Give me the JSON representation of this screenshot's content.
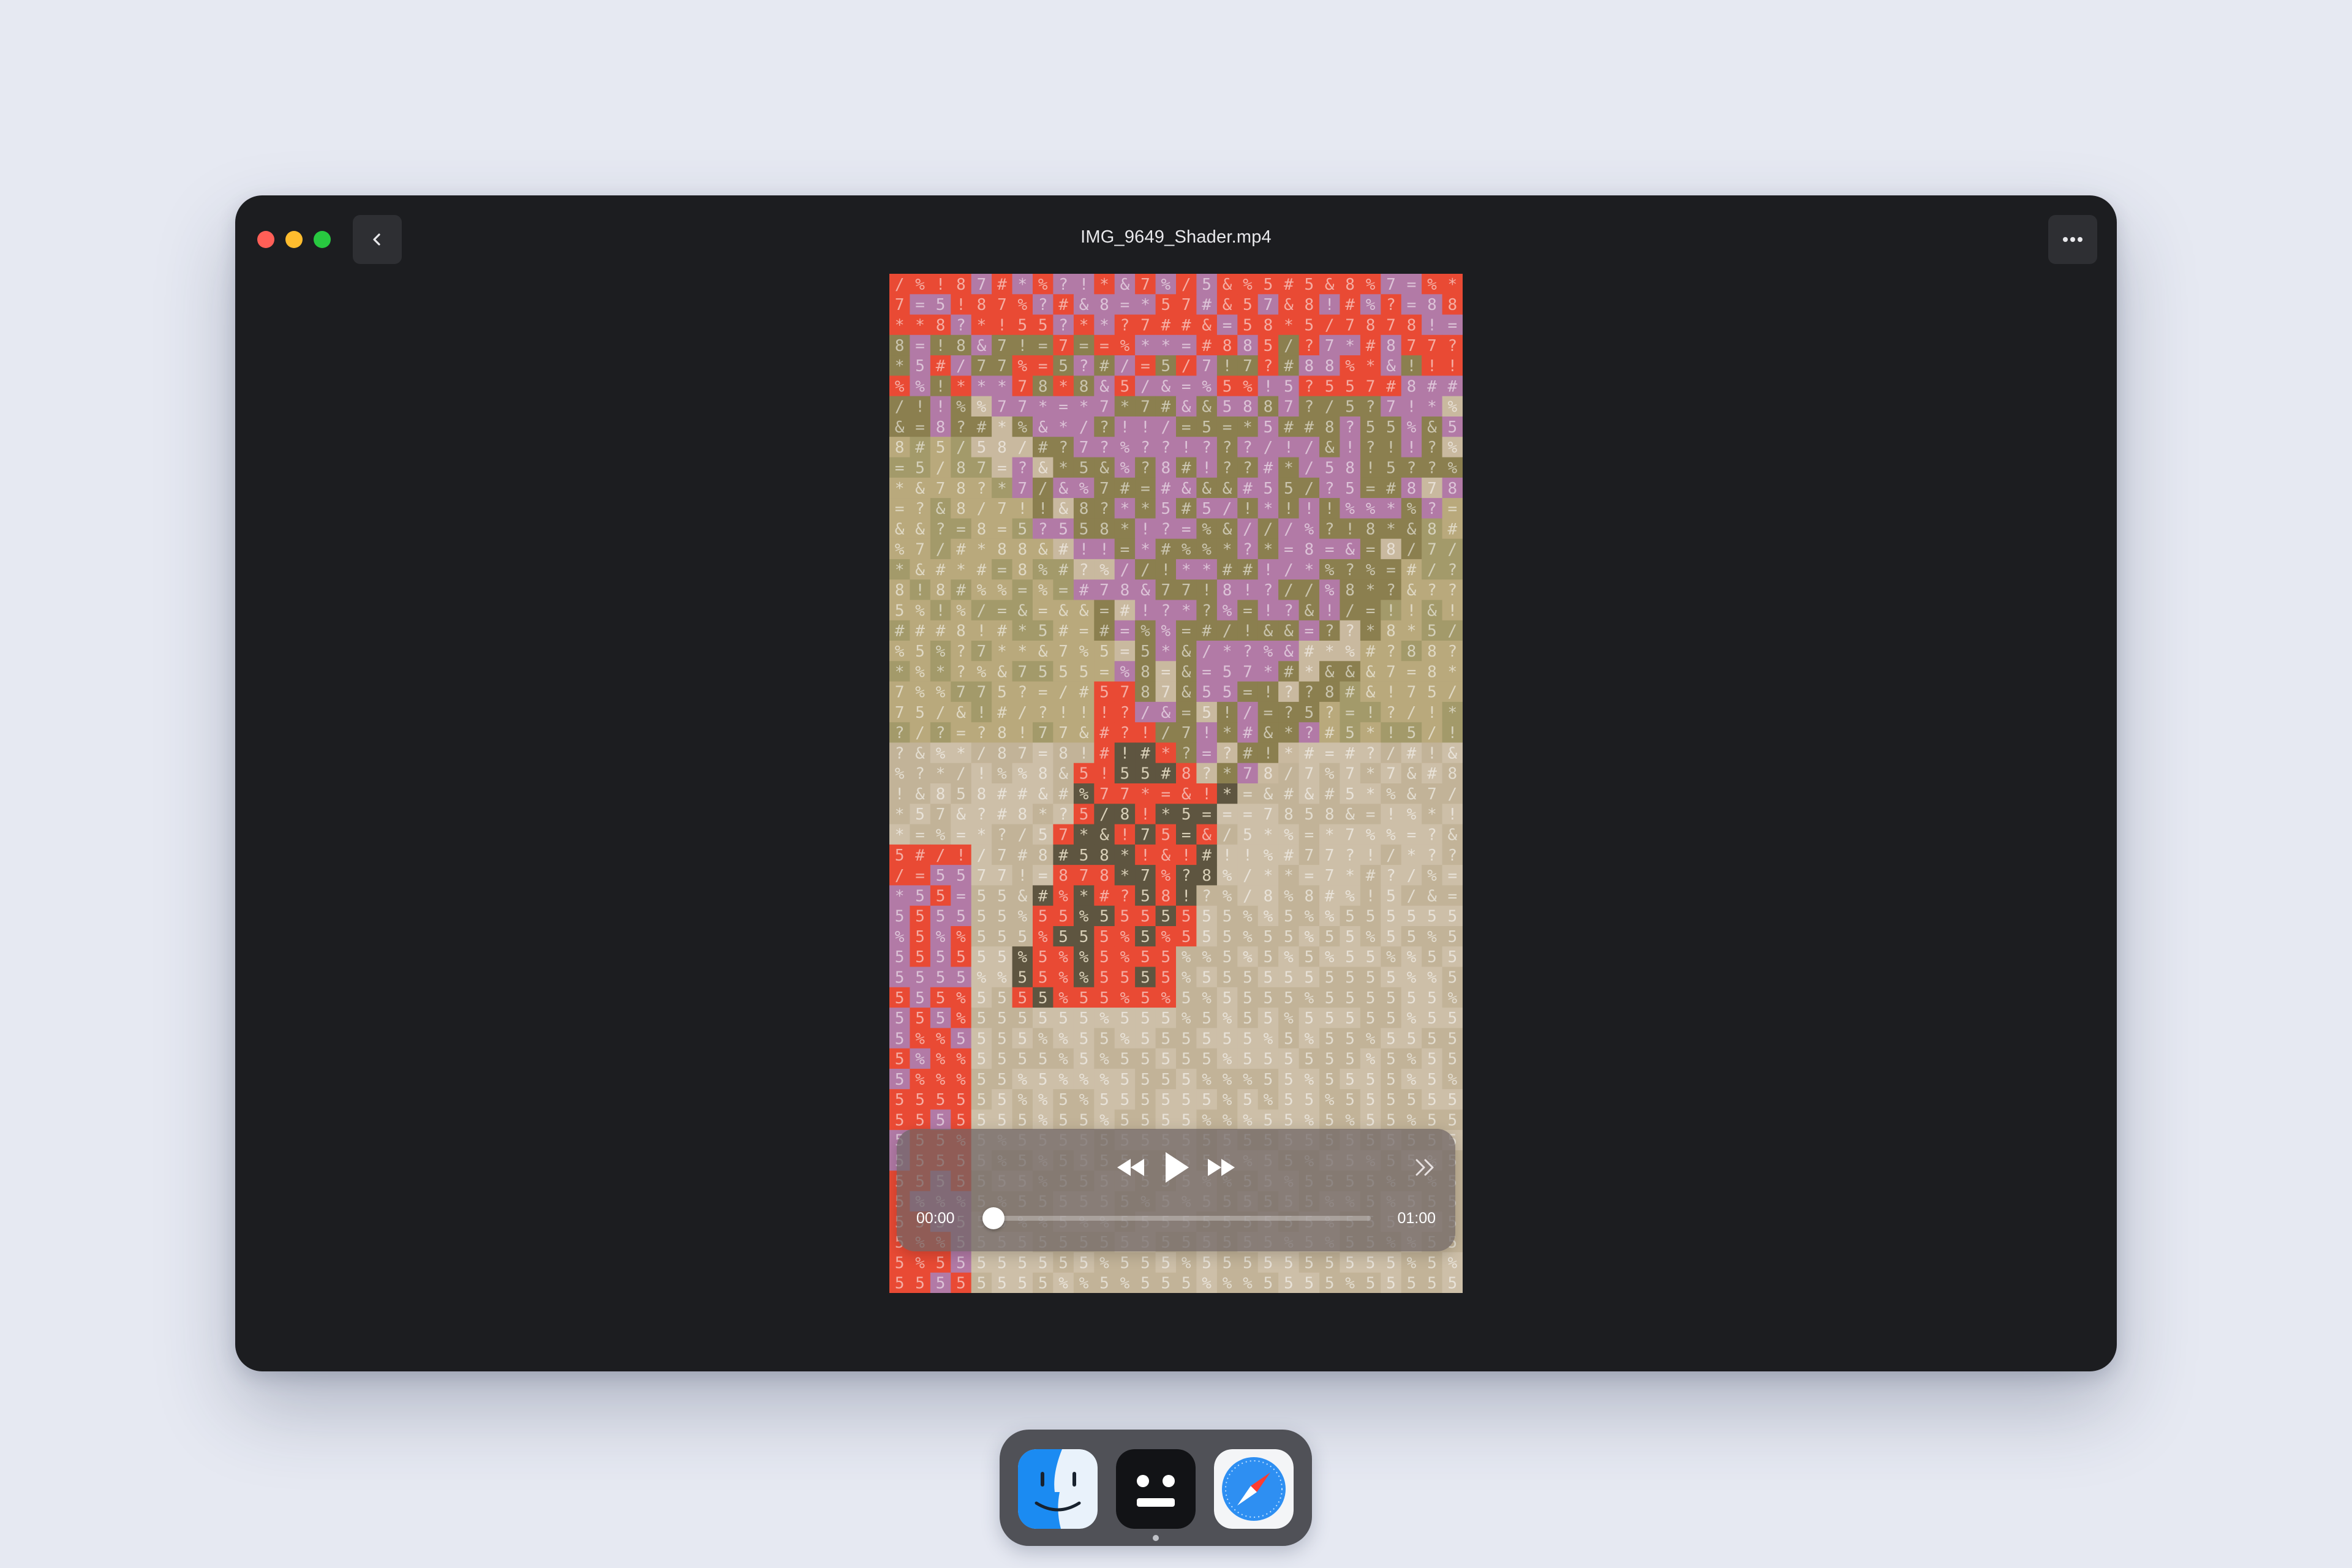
{
  "window": {
    "title": "IMG_9649_Shader.mp4",
    "traffic_lights": [
      "#ff5f57",
      "#febc2e",
      "#28c840"
    ],
    "back_icon": "chevron-left-icon",
    "more_icon": "ellipsis-icon"
  },
  "player": {
    "current_time": "00:00",
    "duration": "01:00",
    "progress": 0.0,
    "buttons": {
      "rewind": "rewind-icon",
      "play": "play-icon",
      "fast_forward": "fast-forward-icon",
      "skip": "double-chevron-right-icon"
    }
  },
  "dock": {
    "apps": [
      "Finder",
      "Robot",
      "Safari"
    ],
    "active_app": "Robot"
  },
  "colors": {
    "desktop": "#e6e9f2",
    "window": "#1c1d20",
    "ascii_red": "#e94a34",
    "ascii_purple": "#b27aa6",
    "ascii_olive": "#8b7f4f",
    "ascii_tan": "#c9b99f",
    "ascii_dark": "#5e5540"
  }
}
